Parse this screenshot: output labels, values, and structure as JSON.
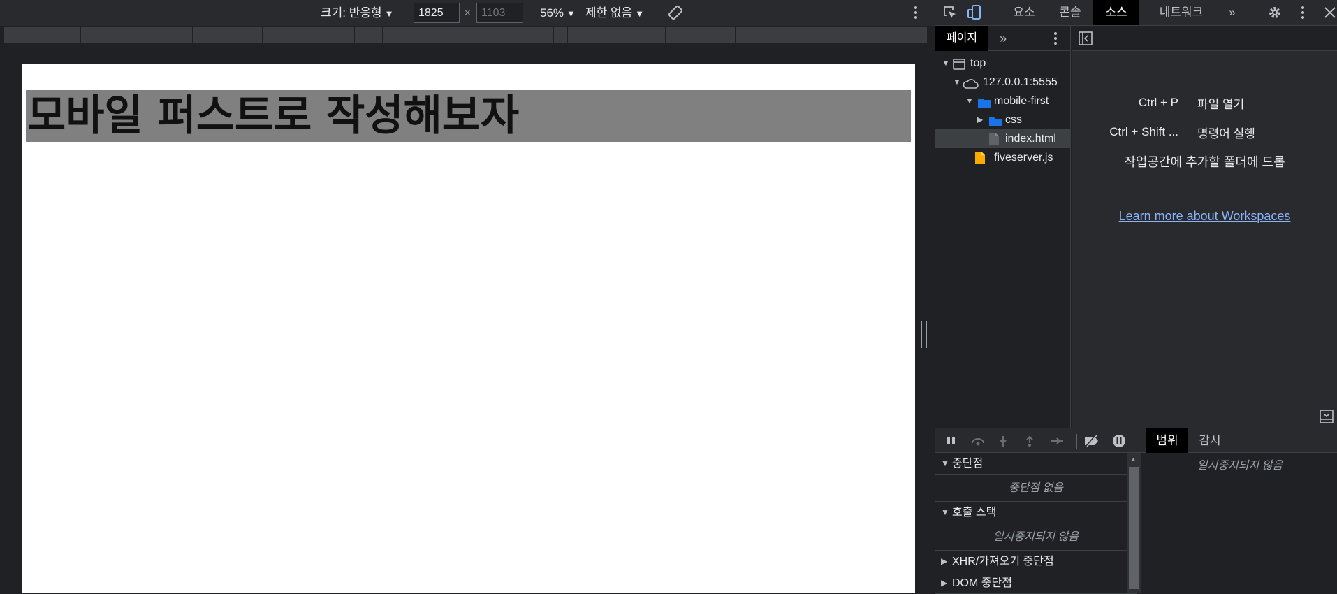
{
  "device_toolbar": {
    "size_label": "크기: 반응형",
    "width_value": "1825",
    "times_sign": "×",
    "height_placeholder": "1103",
    "zoom_label": "56%",
    "throttle_label": "제한 없음"
  },
  "page": {
    "heading": "모바일 퍼스트로 작성해보자"
  },
  "devtools": {
    "tabs": [
      "요소",
      "콘솔",
      "소스",
      "네트워크"
    ],
    "active_tab": "소스",
    "more_tabs_glyph": "»"
  },
  "navigator": {
    "tab_label": "페이지",
    "more_glyph": "»",
    "tree": [
      {
        "label": "top",
        "type": "frame",
        "expanded": true
      },
      {
        "label": "127.0.0.1:5555",
        "type": "cloud",
        "expanded": true
      },
      {
        "label": "mobile-first",
        "type": "folder",
        "expanded": true
      },
      {
        "label": "css",
        "type": "folder",
        "expanded": false
      },
      {
        "label": "index.html",
        "type": "file",
        "selected": true
      },
      {
        "label": "fiveserver.js",
        "type": "script-file"
      }
    ]
  },
  "editor": {
    "shortcuts": [
      {
        "keys": "Ctrl + P",
        "action": "파일 열기"
      },
      {
        "keys": "Ctrl + Shift ...",
        "action": "명령어 실행"
      }
    ],
    "drop_hint": "작업공간에 추가할 폴더에 드롭",
    "workspaces_link": "Learn more about Workspaces"
  },
  "debugger": {
    "side_tabs": [
      "범위",
      "감시"
    ],
    "active_side_tab": "범위",
    "sections": [
      {
        "title": "중단점",
        "body": "중단점 없음",
        "expanded": true
      },
      {
        "title": "호출 스택",
        "body": "일시중지되지 않음",
        "expanded": true
      },
      {
        "title": "XHR/가져오기 중단점",
        "expanded": false
      },
      {
        "title": "DOM 중단점",
        "expanded": false
      }
    ],
    "scope_message": "일시중지되지 않음"
  }
}
